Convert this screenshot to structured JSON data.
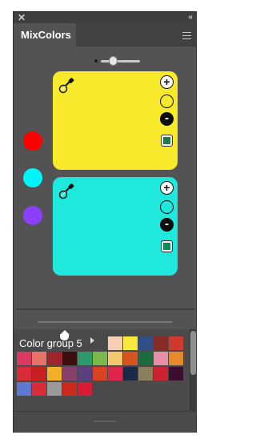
{
  "window": {
    "close_glyph": "✕",
    "collapse_glyph": "‹‹",
    "tab_label": "MixColors",
    "menu_icon": "hamburger-menu-icon"
  },
  "zoom": {
    "level": 0.3
  },
  "source_swatches": [
    {
      "name": "red",
      "color": "#fe0000"
    },
    {
      "name": "cyan",
      "color": "#00f5fb"
    },
    {
      "name": "purple",
      "color": "#8c3ff8"
    }
  ],
  "mixers": [
    {
      "color": "#f8e92c",
      "plus": "+",
      "minus": "-",
      "result_color": "#1f7a52"
    },
    {
      "color": "#1fe8dc",
      "plus": "+",
      "minus": "-",
      "result_color": "#0b8a5a"
    }
  ],
  "ratio_slider": {
    "value": 0.2
  },
  "color_group": {
    "label": "Color group 5",
    "row1": [
      "#f6cfb5",
      "#f6ea3d",
      "#2f4f86",
      "#8a2a25",
      "#cf3a2c"
    ],
    "rows": [
      [
        "#d83a64",
        "#e8716a",
        "#a1242c",
        "#3d0f0f",
        "#2e9a6c",
        "#7ab84c",
        "#f0c76a",
        "#d8541e",
        "#1c6c3e",
        "#e88fa8",
        "#e78a2c"
      ],
      [
        "#d92c3a",
        "#c82020",
        "#f0b02a",
        "#88406d",
        "#5a4080",
        "#d84324",
        "#df2648",
        "#1b2a44",
        "#8a8060",
        "#cc2231",
        "#3a0f2d"
      ],
      [
        "#5e7ad0",
        "#d82c38",
        "#9a9a9a",
        "#cc2a1a",
        "#d81a34"
      ]
    ]
  }
}
